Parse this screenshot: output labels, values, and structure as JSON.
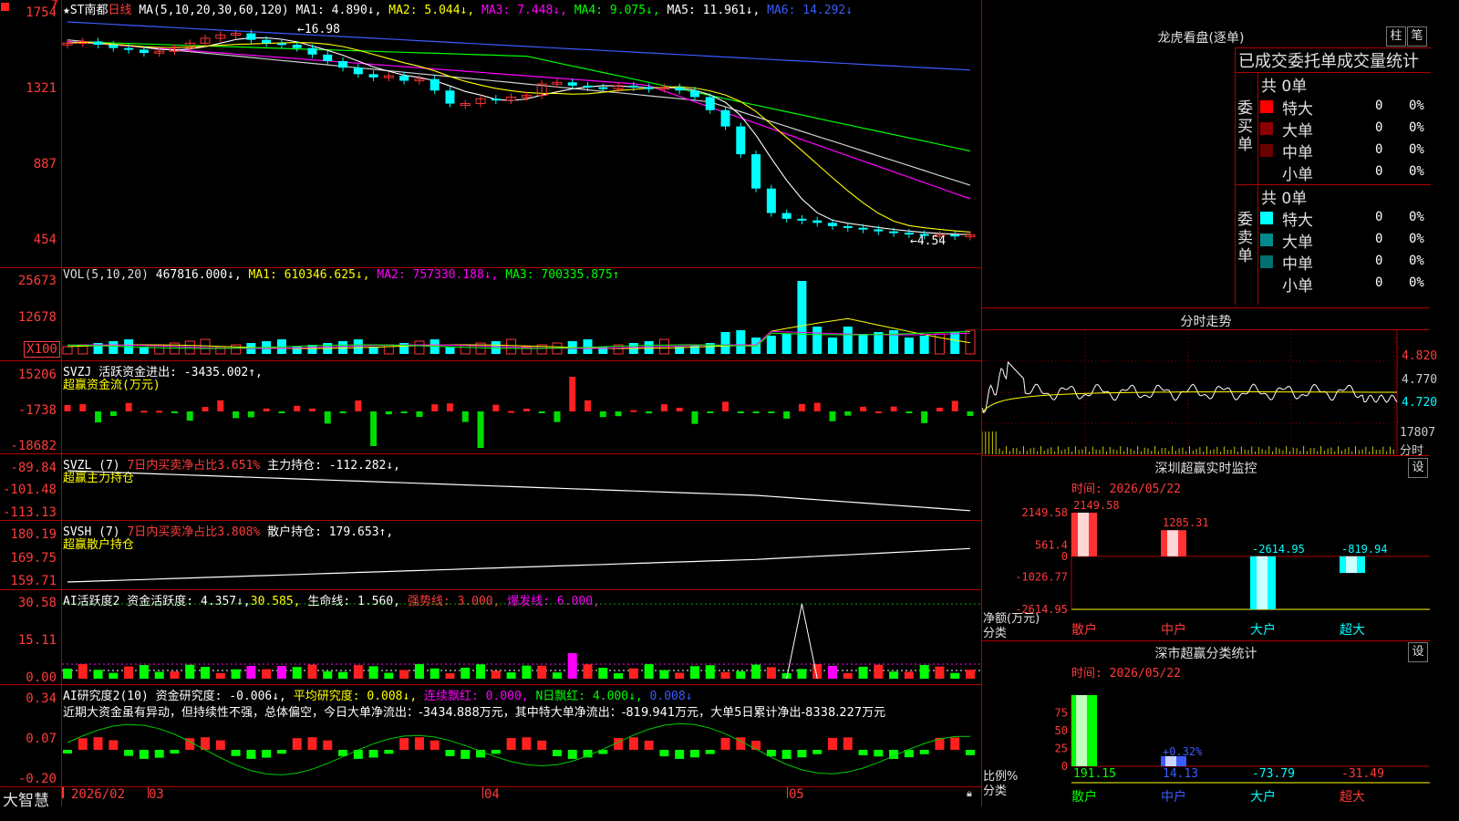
{
  "main": {
    "stock_name": "★ST南都",
    "period": "日线",
    "ma_header": "MA(5,10,20,30,60,120)",
    "ma_values": [
      {
        "label": "MA1: 4.890↓,",
        "color": "#ffffff"
      },
      {
        "label": "MA2: 5.044↓,",
        "color": "#ffff00"
      },
      {
        "label": "MA3: 7.448↓,",
        "color": "#ff00ff"
      },
      {
        "label": "MA4: 9.075↓,",
        "color": "#00ff00"
      },
      {
        "label": "MA5: 11.961↓,",
        "color": "#ffffff"
      },
      {
        "label": "MA6: 14.292↓",
        "color": "#3a5cff"
      }
    ],
    "y_ticks": [
      "1754",
      "1321",
      "887",
      "454"
    ],
    "high_marker": "16.98",
    "low_marker": "4.54",
    "top_icon_red": "7",
    "top_icon_sq": "▪"
  },
  "vol": {
    "header": "VOL(5,10,20)",
    "value": "467816.000↓,",
    "ma1": "MA1: 610346.625↓,",
    "ma2": "MA2: 757330.188↓,",
    "ma3": "MA3: 700335.875↑",
    "y_ticks": [
      "25673",
      "12678",
      "X100"
    ]
  },
  "svzj": {
    "header": "SVZJ  活跃资金进出: -3435.002↑,",
    "sub": "超赢资金流(万元)",
    "y_ticks": [
      "15206",
      "-1738",
      "-18682"
    ]
  },
  "svzl": {
    "header_a": "SVZL (7) ",
    "header_b": "7日内买卖净占比3.651%",
    "header_c": " 主力持仓: -112.282↓,",
    "sub": "超赢主力持仓",
    "y_ticks": [
      "-89.84",
      "-101.48",
      "-113.13"
    ]
  },
  "svsh": {
    "header_a": "SVSH (7) ",
    "header_b": "7日内买卖净占比3.808%",
    "header_c": " 散户持仓: 179.653↑,",
    "sub": "超赢散户持仓",
    "y_ticks": [
      "180.19",
      "169.75",
      "159.71"
    ]
  },
  "ai_active": {
    "header_a": "AI活跃度2 资金活跃度: 4.357↓,",
    "header_b": "30.585,",
    "header_c": " 生命线: 1.560,",
    "header_d": " 强势线: 3.000,",
    "header_e": " 爆发线: 6.000,",
    "y_ticks": [
      "30.58",
      "15.11",
      "0.00"
    ]
  },
  "ai_research": {
    "header_a": "AI研究度2(10) 资金研究度: -0.006↓,",
    "header_b": " 平均研究度: 0.008↓,",
    "header_c": " 连续飘红: 0.000,",
    "header_d": " N日飘红: 4.000↓,",
    "header_e": " 0.008↓",
    "comment": "近期大资金虽有异动，但持续性不强，总体偏空，今日大单净流出：-3434.888万元，其中特大单净流出：-819.941万元，大单5日累计净出-8338.227万元",
    "y_ticks": [
      "0.34",
      "0.07",
      "-0.20"
    ]
  },
  "footer": {
    "brand": "大智慧",
    "dates": [
      "2026/02",
      "03",
      "04",
      "05"
    ]
  },
  "right": {
    "lhb_title": "龙虎看盘(逐单)",
    "btn_zhu": "柱",
    "btn_bi": "笔",
    "stat_title": "已成交委托单成交量统计",
    "buy_label": "委买单",
    "sell_label": "委卖单",
    "buy_total": "共 0单",
    "sell_total": "共 0单",
    "buy_rows": [
      {
        "name": "特大",
        "count": "0",
        "pct": "0%",
        "color": "#ff0000"
      },
      {
        "name": "大单",
        "count": "0",
        "pct": "0%",
        "color": "#8b0000"
      },
      {
        "name": "中单",
        "count": "0",
        "pct": "0%",
        "color": "#6a0000"
      },
      {
        "name": "小单",
        "count": "0",
        "pct": "0%",
        "color": "#000000"
      }
    ],
    "sell_rows": [
      {
        "name": "特大",
        "count": "0",
        "pct": "0%",
        "color": "#00ffff"
      },
      {
        "name": "大单",
        "count": "0",
        "pct": "0%",
        "color": "#008b8b"
      },
      {
        "name": "中单",
        "count": "0",
        "pct": "0%",
        "color": "#007070"
      },
      {
        "name": "小单",
        "count": "0",
        "pct": "0%",
        "color": "#000000"
      }
    ],
    "intraday_title": "分时走势",
    "intraday_prices": [
      "4.820",
      "4.770",
      "4.720"
    ],
    "intraday_vol": "17807",
    "intraday_vol_unit": "分时",
    "monitor_title": "深圳超赢实时监控",
    "monitor_setting": "设",
    "monitor_time": "时间: 2026/05/22",
    "monitor_y": [
      "2149.58",
      "561.4",
      "0",
      "-1026.77",
      "-2614.95"
    ],
    "monitor_axis_unit": "净额(万元)",
    "monitor_axis_cat": "分类",
    "monitor_bars": [
      {
        "cat": "散户",
        "value": 2149.58,
        "label": "2149.58",
        "color": "#ff3333"
      },
      {
        "cat": "中户",
        "value": 1285.31,
        "label": "1285.31",
        "color": "#ff3333"
      },
      {
        "cat": "大户",
        "value": -2614.95,
        "label": "-2614.95",
        "color": "#00ffff"
      },
      {
        "cat": "超大",
        "value": -819.94,
        "label": "-819.94",
        "color": "#00ffff"
      }
    ],
    "stat2_title": "深市超赢分类统计",
    "stat2_setting": "设",
    "stat2_time": "时间: 2026/05/22",
    "stat2_y": [
      "75",
      "50",
      "25",
      "0"
    ],
    "stat2_axis_unit": "比例%",
    "stat2_axis_cat": "分类",
    "stat2_bars": [
      {
        "cat": "散户",
        "value": 191.15,
        "label": "191.15",
        "color": "#00ff00"
      },
      {
        "cat": "中户",
        "value": 14.13,
        "label": "14.13",
        "color": "#3a5cff",
        "note": "+0.32%"
      },
      {
        "cat": "大户",
        "value": -73.79,
        "label": "-73.79",
        "color": "#00ffff"
      },
      {
        "cat": "超大",
        "value": -31.49,
        "label": "-31.49",
        "color": "#ff3333"
      }
    ]
  }
}
